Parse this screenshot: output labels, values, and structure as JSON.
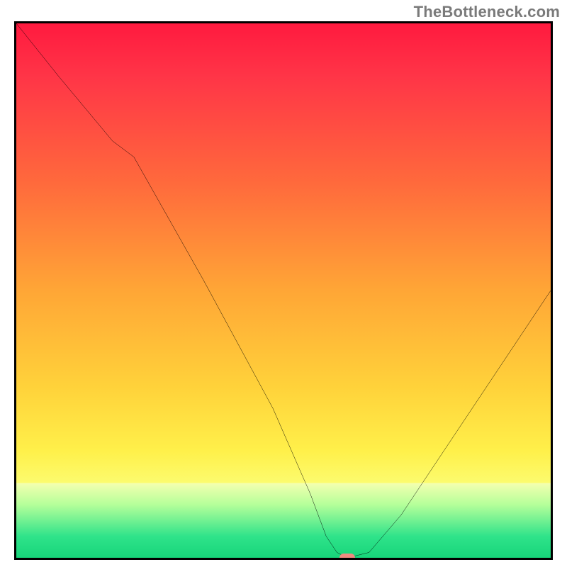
{
  "watermark": "TheBottleneck.com",
  "colors": {
    "border": "#000000",
    "curve": "#000000",
    "marker": "#ef8b80",
    "gradient_top": "#ff1a3f",
    "gradient_mid": "#ffd23a",
    "gradient_bottom": "#17d57a"
  },
  "chart_data": {
    "type": "line",
    "title": "",
    "xlabel": "",
    "ylabel": "",
    "xlim": [
      0,
      100
    ],
    "ylim": [
      0,
      100
    ],
    "grid": false,
    "legend": false,
    "x": [
      0,
      8,
      18,
      22,
      35,
      48,
      55,
      58,
      60,
      62,
      64,
      66,
      72,
      80,
      90,
      100
    ],
    "values": [
      100,
      90,
      78,
      75,
      52,
      28,
      12,
      4,
      1,
      0,
      0.5,
      1,
      8,
      20,
      35,
      50
    ],
    "marker": {
      "x": 62,
      "y": 0
    },
    "note": "Axis numeric scales are not shown in the image; x and y are expressed in 0–100 normalized units inferred from the plot frame. 0 on y is the green bottom edge; 100 is the top (red). The curve falls steeply from top-left, flattens briefly around x≈20, dives to a minimum near x≈62 where a small marker sits on the baseline, then rises roughly linearly toward the right edge reaching mid-height."
  }
}
